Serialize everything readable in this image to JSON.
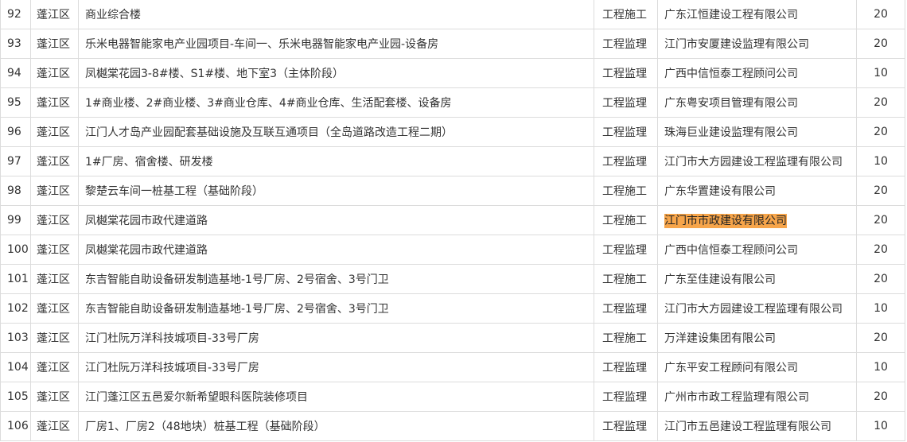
{
  "table": {
    "rows": [
      {
        "no": "92",
        "district": "蓬江区",
        "project": "商业综合楼",
        "type": "工程施工",
        "company": "广东江恒建设工程有限公司",
        "score": "20"
      },
      {
        "no": "93",
        "district": "蓬江区",
        "project": "乐米电器智能家电产业园项目-车间一、乐米电器智能家电产业园-设备房",
        "type": "工程监理",
        "company": "江门市安厦建设监理有限公司",
        "score": "20"
      },
      {
        "no": "94",
        "district": "蓬江区",
        "project": "凤樾棠花园3-8#楼、S1#楼、地下室3（主体阶段）",
        "type": "工程监理",
        "company": "广西中信恒泰工程顾问公司",
        "score": "10"
      },
      {
        "no": "95",
        "district": "蓬江区",
        "project": "1#商业楼、2#商业楼、3#商业仓库、4#商业仓库、生活配套楼、设备房",
        "type": "工程监理",
        "company": "广东粤安项目管理有限公司",
        "score": "20"
      },
      {
        "no": "96",
        "district": "蓬江区",
        "project": "江门人才岛产业园配套基础设施及互联互通项目（全岛道路改造工程二期）",
        "type": "工程监理",
        "company": "珠海巨业建设监理有限公司",
        "score": "20"
      },
      {
        "no": "97",
        "district": "蓬江区",
        "project": "1#厂房、宿舍楼、研发楼",
        "type": "工程监理",
        "company": "江门市大方园建设工程监理有限公司",
        "score": "10"
      },
      {
        "no": "98",
        "district": "蓬江区",
        "project": "黎楚云车间一桩基工程（基础阶段）",
        "type": "工程施工",
        "company": "广东华置建设有限公司",
        "score": "20"
      },
      {
        "no": "99",
        "district": "蓬江区",
        "project": "凤樾棠花园市政代建道路",
        "type": "工程施工",
        "company": "江门市市政建设有限公司",
        "score": "20",
        "highlight": true
      },
      {
        "no": "100",
        "district": "蓬江区",
        "project": "凤樾棠花园市政代建道路",
        "type": "工程监理",
        "company": "广西中信恒泰工程顾问公司",
        "score": "20"
      },
      {
        "no": "101",
        "district": "蓬江区",
        "project": "东吉智能自助设备研发制造基地-1号厂房、2号宿舍、3号门卫",
        "type": "工程施工",
        "company": "广东至佳建设有限公司",
        "score": "20"
      },
      {
        "no": "102",
        "district": "蓬江区",
        "project": "东吉智能自助设备研发制造基地-1号厂房、2号宿舍、3号门卫",
        "type": "工程监理",
        "company": "江门市大方园建设工程监理有限公司",
        "score": "10"
      },
      {
        "no": "103",
        "district": "蓬江区",
        "project": "江门杜阮万洋科技城项目-33号厂房",
        "type": "工程施工",
        "company": "万洋建设集团有限公司",
        "score": "20"
      },
      {
        "no": "104",
        "district": "蓬江区",
        "project": "江门杜阮万洋科技城项目-33号厂房",
        "type": "工程监理",
        "company": "广东平安工程顾问有限公司",
        "score": "10"
      },
      {
        "no": "105",
        "district": "蓬江区",
        "project": "江门蓬江区五邑爱尔新希望眼科医院装修项目",
        "type": "工程监理",
        "company": "广州市市政工程监理有限公司",
        "score": "20"
      },
      {
        "no": "106",
        "district": "蓬江区",
        "project": "厂房1、厂房2（48地块）桩基工程（基础阶段）",
        "type": "工程监理",
        "company": "江门市五邑建设工程监理有限公司",
        "score": "10"
      }
    ]
  }
}
